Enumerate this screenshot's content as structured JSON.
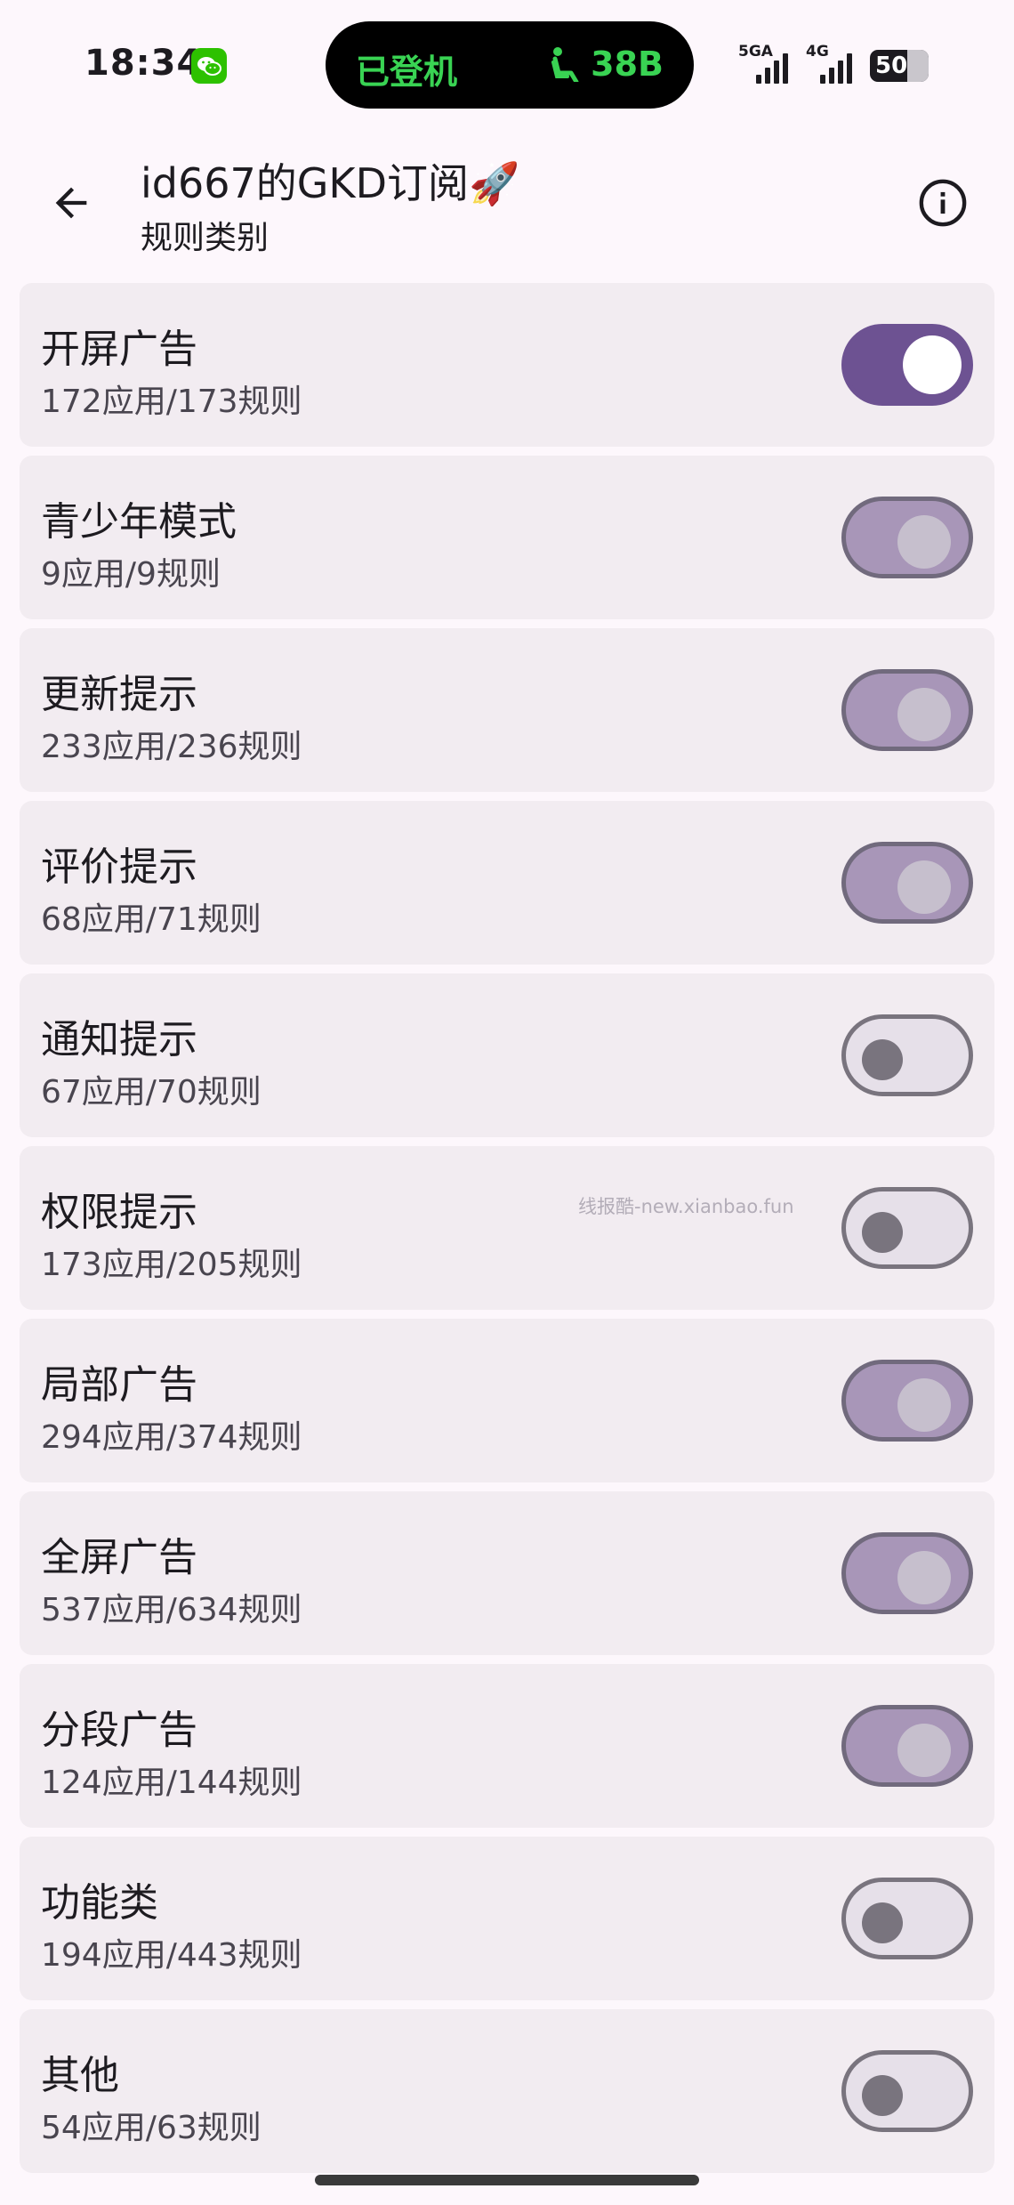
{
  "status_bar": {
    "time": "18:34",
    "island_left": "已登机",
    "island_right": "38B",
    "signal_1_label": "5GA",
    "signal_2_label": "4G",
    "battery": "50"
  },
  "header": {
    "title": "id667的GKD订阅🚀",
    "subtitle": "规则类别"
  },
  "rules": [
    {
      "name": "开屏广告",
      "count": "172应用/173规则",
      "state": "on"
    },
    {
      "name": "青少年模式",
      "count": "9应用/9规则",
      "state": "dim"
    },
    {
      "name": "更新提示",
      "count": "233应用/236规则",
      "state": "dim"
    },
    {
      "name": "评价提示",
      "count": "68应用/71规则",
      "state": "dim"
    },
    {
      "name": "通知提示",
      "count": "67应用/70规则",
      "state": "off"
    },
    {
      "name": "权限提示",
      "count": "173应用/205规则",
      "state": "off"
    },
    {
      "name": "局部广告",
      "count": "294应用/374规则",
      "state": "dim"
    },
    {
      "name": "全屏广告",
      "count": "537应用/634规则",
      "state": "dim"
    },
    {
      "name": "分段广告",
      "count": "124应用/144规则",
      "state": "dim"
    },
    {
      "name": "功能类",
      "count": "194应用/443规则",
      "state": "off"
    },
    {
      "name": "其他",
      "count": "54应用/63规则",
      "state": "off"
    }
  ],
  "watermark": "线报酷-new.xianbao.fun",
  "colors": {
    "background": "#fdf7fc",
    "card": "#f2ecf1",
    "switch_on": "#6d5292",
    "switch_dim": "#a896b8",
    "island_text": "#39d353"
  },
  "icons": {
    "back": "arrow-left",
    "info": "info-circle",
    "wechat": "wechat",
    "seat": "seat"
  }
}
